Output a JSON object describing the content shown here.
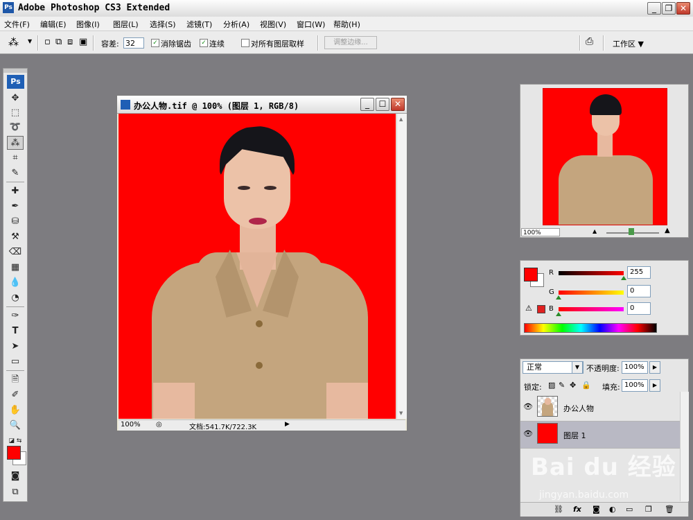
{
  "app": {
    "title": "Adobe Photoshop CS3 Extended",
    "icon_label": "Ps"
  },
  "window_controls": {
    "minimize": "_",
    "restore": "❐",
    "close": "✕"
  },
  "menu": [
    {
      "label": "文件(F)"
    },
    {
      "label": "编辑(E)"
    },
    {
      "label": "图像(I)"
    },
    {
      "label": "图层(L)"
    },
    {
      "label": "选择(S)"
    },
    {
      "label": "滤镜(T)"
    },
    {
      "label": "分析(A)"
    },
    {
      "label": "视图(V)"
    },
    {
      "label": "窗口(W)"
    },
    {
      "label": "帮助(H)"
    }
  ],
  "options": {
    "tolerance_label": "容差:",
    "tolerance_value": "32",
    "antialias_label": "消除锯齿",
    "antialias_checked": true,
    "contiguous_label": "连续",
    "contiguous_checked": true,
    "sample_all_label": "对所有图层取样",
    "sample_all_checked": false,
    "refine_edge_label": "调整边缘...",
    "workspace_label": "工作区 ▼"
  },
  "toolbox": {
    "logo": "Ps"
  },
  "document": {
    "title": "办公人物.tif @ 100% (图层 1, RGB/8)",
    "zoom": "100%",
    "doc_size": "文档:541.7K/722.3K"
  },
  "navigator": {
    "zoom": "100%"
  },
  "color": {
    "foreground": "#ff0000",
    "r_label": "R",
    "r_value": "255",
    "g_label": "G",
    "g_value": "0",
    "b_label": "B",
    "b_value": "0"
  },
  "layers": {
    "blend_mode": "正常",
    "opacity_label": "不透明度:",
    "opacity_value": "100%",
    "lock_label": "锁定:",
    "fill_label": "填充:",
    "fill_value": "100%",
    "items": [
      {
        "name": "办公人物",
        "selected": false
      },
      {
        "name": "图层 1",
        "selected": true
      }
    ]
  },
  "watermark": {
    "brand": "Bai du 经验",
    "url": "jingyan.baidu.com"
  }
}
